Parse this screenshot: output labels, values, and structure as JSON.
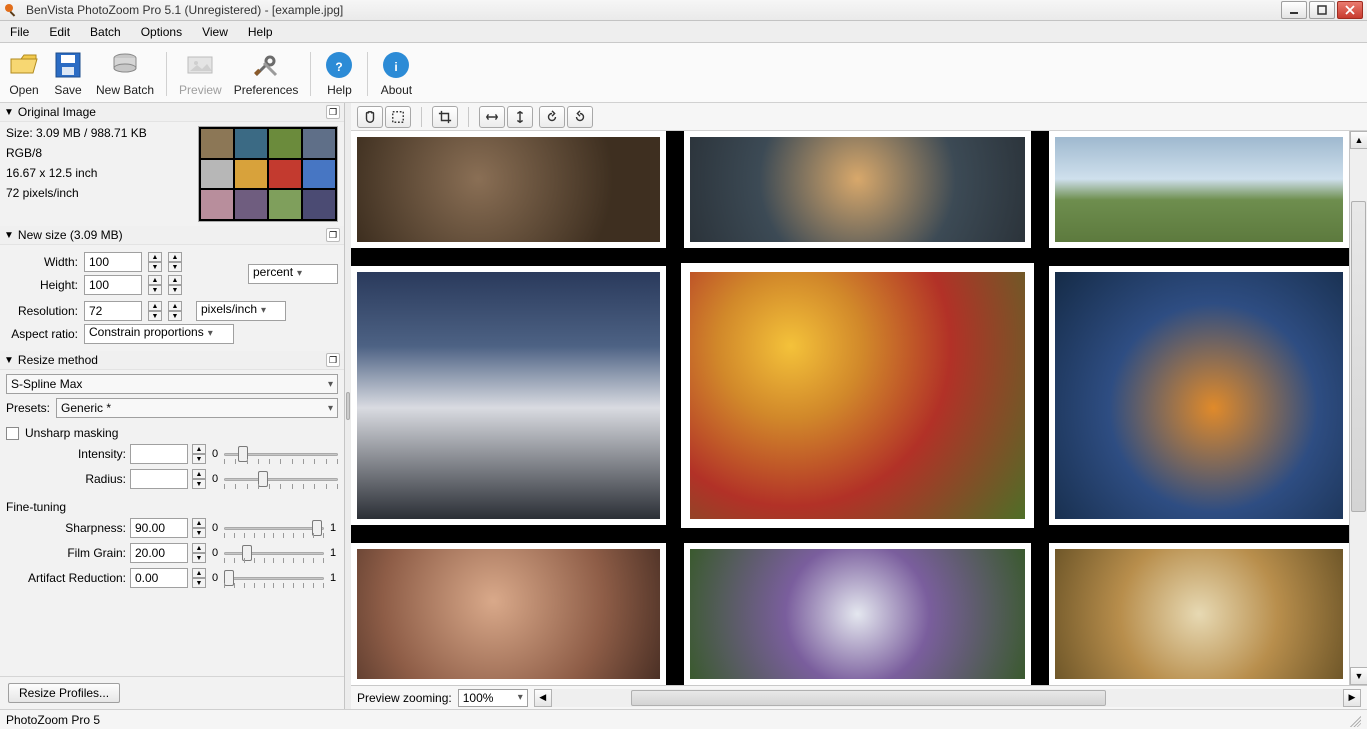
{
  "window": {
    "title": "BenVista PhotoZoom Pro 5.1 (Unregistered) - [example.jpg]"
  },
  "menu": [
    "File",
    "Edit",
    "Batch",
    "Options",
    "View",
    "Help"
  ],
  "toolbar": [
    {
      "id": "open",
      "label": "Open",
      "disabled": false
    },
    {
      "id": "save",
      "label": "Save",
      "disabled": false
    },
    {
      "id": "newbatch",
      "label": "New Batch",
      "disabled": false
    },
    {
      "id": "sep"
    },
    {
      "id": "preview",
      "label": "Preview",
      "disabled": true
    },
    {
      "id": "prefs",
      "label": "Preferences",
      "disabled": false
    },
    {
      "id": "sep"
    },
    {
      "id": "help",
      "label": "Help",
      "disabled": false
    },
    {
      "id": "sep"
    },
    {
      "id": "about",
      "label": "About",
      "disabled": false
    }
  ],
  "left": {
    "original": {
      "header": "Original Image",
      "size": "Size: 3.09 MB / 988.71 KB",
      "mode": "RGB/8",
      "dims": "16.67 x 12.5 inch",
      "res": "72 pixels/inch"
    },
    "newsize": {
      "header": "New size (3.09 MB)",
      "width_label": "Width:",
      "width": "100",
      "height_label": "Height:",
      "height": "100",
      "unit": "percent",
      "resolution_label": "Resolution:",
      "resolution": "72",
      "res_unit": "pixels/inch",
      "aspect_label": "Aspect ratio:",
      "aspect": "Constrain proportions"
    },
    "resize": {
      "header": "Resize method",
      "method": "S-Spline Max",
      "presets_label": "Presets:",
      "preset": "Generic *",
      "unsharp_label": "Unsharp masking",
      "intensity_label": "Intensity:",
      "intensity": "",
      "intensity_min": "0",
      "radius_label": "Radius:",
      "radius": "",
      "radius_min": "0",
      "finetune_label": "Fine-tuning",
      "sharpness_label": "Sharpness:",
      "sharpness": "90.00",
      "grain_label": "Film Grain:",
      "grain": "20.00",
      "artifact_label": "Artifact Reduction:",
      "artifact": "0.00",
      "range_min": "0",
      "range_max": "1"
    },
    "resize_profiles_btn": "Resize Profiles..."
  },
  "preview_bar": {
    "label": "Preview zooming:",
    "zoom": "100%"
  },
  "status": {
    "text": "PhotoZoom Pro 5"
  }
}
